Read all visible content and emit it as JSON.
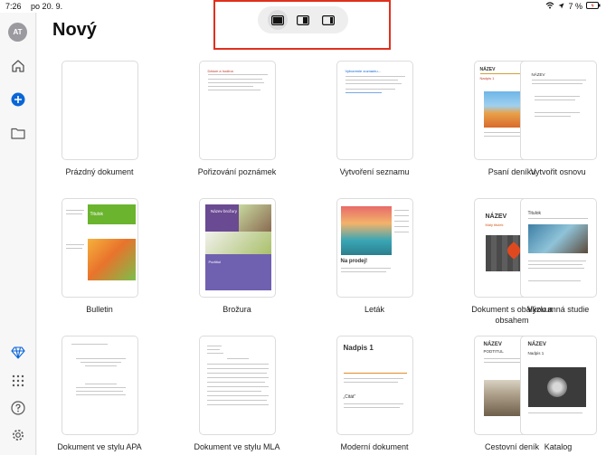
{
  "status_bar": {
    "time": "7:26",
    "date": "po 20. 9.",
    "battery": "7 %"
  },
  "sidebar": {
    "avatar_initials": "AT",
    "icons": [
      "home-icon",
      "plus-icon",
      "folder-icon",
      "diamond-icon",
      "apps-grid-icon",
      "help-icon",
      "gear-icon"
    ]
  },
  "layout_switcher": {
    "options": [
      "full-layout",
      "split-layout",
      "sidebar-layout"
    ],
    "selected": "full-layout"
  },
  "page": {
    "title": "Nový"
  },
  "templates": [
    {
      "label": "Prázdný dokument"
    },
    {
      "label": "Pořizování poznámek",
      "thumb_title": "Dátum a hodina"
    },
    {
      "label": "Vytvoření seznamu",
      "thumb_title": "Vytvorenie zoznamu..."
    },
    {
      "label": "Psaní deníku",
      "thumb_title": "NÁZEV",
      "thumb_sub": "Nadpis 1"
    },
    {
      "label": "Vytvořit osnovu",
      "thumb_title": "NÁZEV"
    },
    {
      "label": "Bulletin",
      "thumb_title": "Titulok"
    },
    {
      "label": "Brožura",
      "thumb_title": "Název brožury",
      "thumb_sub": "Podtitul"
    },
    {
      "label": "Leták",
      "thumb_title": "Na prodej!"
    },
    {
      "label": "Dokument s obálkou a obsahem",
      "thumb_title": "NÁZEV",
      "thumb_sub": "Malý titulek"
    },
    {
      "label": "Výzkumná studie",
      "thumb_title": "Titulok"
    },
    {
      "label": "Dokument ve stylu APA"
    },
    {
      "label": "Dokument ve stylu MLA"
    },
    {
      "label": "Moderní dokument",
      "thumb_title": "Nadpis 1",
      "thumb_sub": "„Citát“"
    },
    {
      "label": "Cestovní deník",
      "thumb_title": "NÁZEV",
      "thumb_sub": "PODTITUL"
    },
    {
      "label": "Katalog",
      "thumb_title": "NÁZEV",
      "thumb_sub": "Nadpis 1"
    }
  ],
  "colors": {
    "accent": "#0a66d8",
    "highlight": "#e0301e",
    "brochure_purple": "#6a4a92",
    "bulletin_green": "#6ab42e"
  }
}
